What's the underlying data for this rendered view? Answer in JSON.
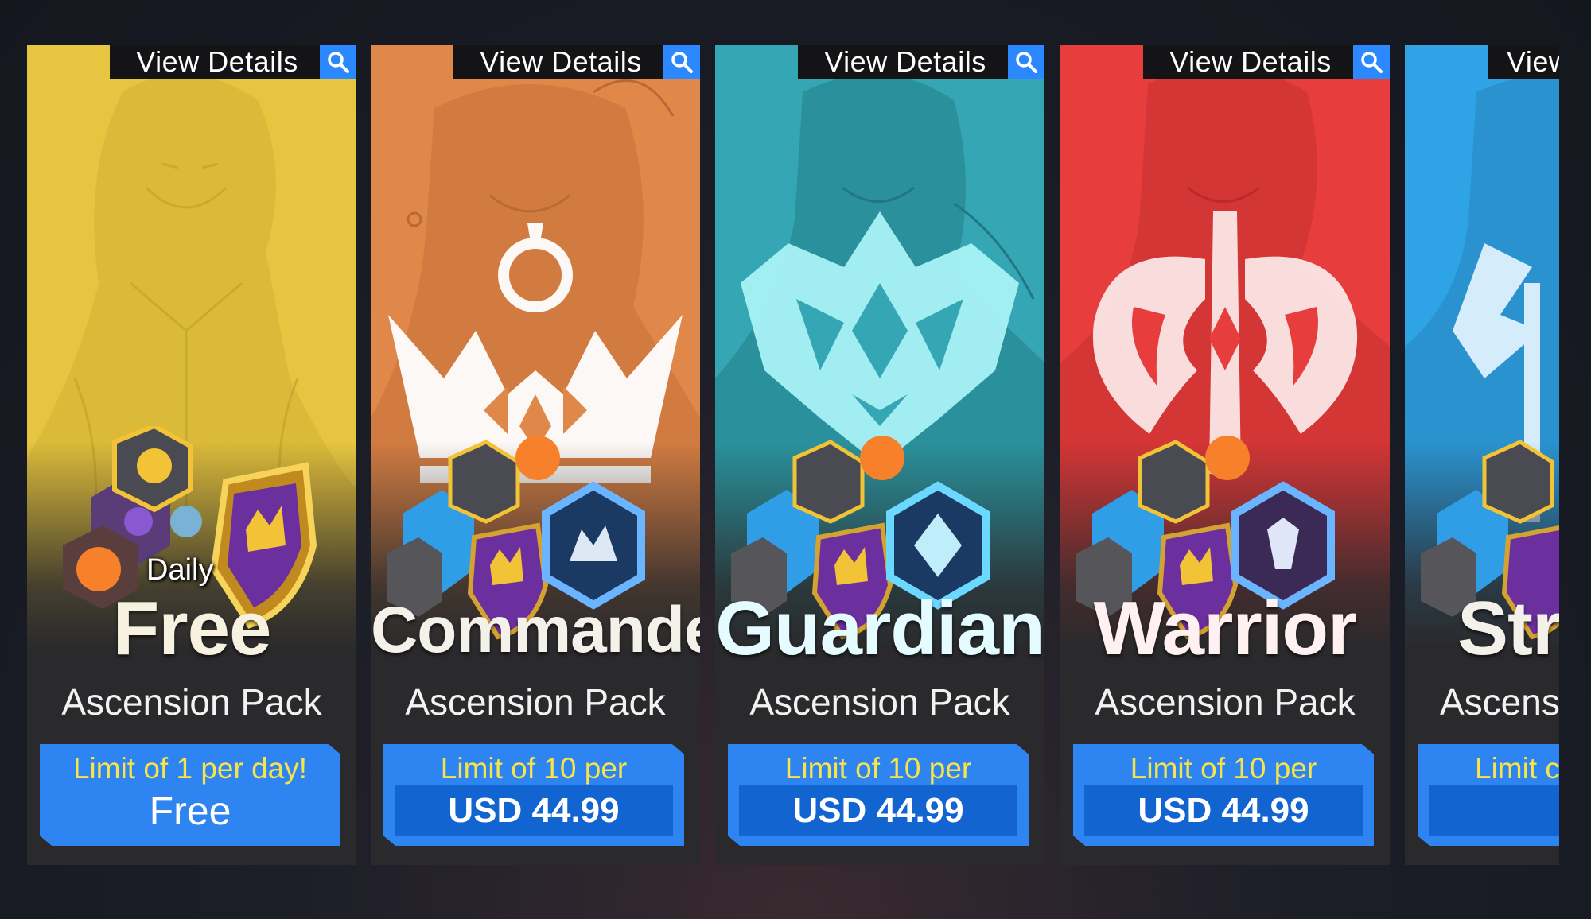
{
  "shop": {
    "cards": [
      {
        "view_details": "View Details",
        "badge": "Daily",
        "name": "Free",
        "subtitle": "Ascension Pack",
        "limit": "Limit of 1 per day!",
        "price": "Free",
        "bg": "#e6c640"
      },
      {
        "view_details": "View Details",
        "name": "Commander",
        "subtitle": "Ascension Pack",
        "limit": "Limit of 10 per",
        "price": "USD 44.99",
        "bg": "#e0884a"
      },
      {
        "view_details": "View Details",
        "name": "Guardian",
        "subtitle": "Ascension Pack",
        "limit": "Limit of 10 per",
        "price": "USD 44.99",
        "bg": "#35a7b4"
      },
      {
        "view_details": "View Details",
        "name": "Warrior",
        "subtitle": "Ascension Pack",
        "limit": "Limit of 10 per",
        "price": "USD 44.99",
        "bg": "#e83d3d"
      },
      {
        "view_details": "View",
        "name": "Str",
        "subtitle": "Ascens",
        "limit": "Limit c",
        "price": "",
        "bg": "#2ea3e6"
      }
    ]
  },
  "colors": {
    "button_blue": "#2e84f0",
    "limit_text": "#f7e34a",
    "search_icon_bg": "#2b88ff"
  }
}
